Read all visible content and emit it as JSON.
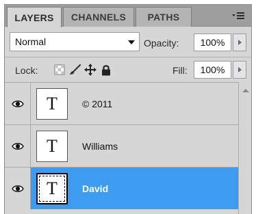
{
  "tabs": [
    {
      "label": "LAYERS",
      "active": true
    },
    {
      "label": "CHANNELS",
      "active": false
    },
    {
      "label": "PATHS",
      "active": false
    }
  ],
  "panel_menu_icon": "panel-menu-icon",
  "blend": {
    "mode": "Normal",
    "opacity_label": "Opacity:",
    "opacity_value": "100%"
  },
  "lock": {
    "label": "Lock:",
    "icons": [
      "lock-transparent-pixels-icon",
      "lock-image-pixels-icon",
      "lock-position-icon",
      "lock-all-icon"
    ]
  },
  "fill": {
    "label": "Fill:",
    "value": "100%"
  },
  "layers": [
    {
      "name": "© 2011",
      "type_glyph": "T",
      "visible": true,
      "selected": false
    },
    {
      "name": "Williams",
      "type_glyph": "T",
      "visible": true,
      "selected": false
    },
    {
      "name": "David",
      "type_glyph": "T",
      "visible": true,
      "selected": true
    }
  ],
  "colors": {
    "selection": "#3d9bf0",
    "panel_bg": "#d6d6d6",
    "tabbar_bg": "#9e9e9e"
  }
}
